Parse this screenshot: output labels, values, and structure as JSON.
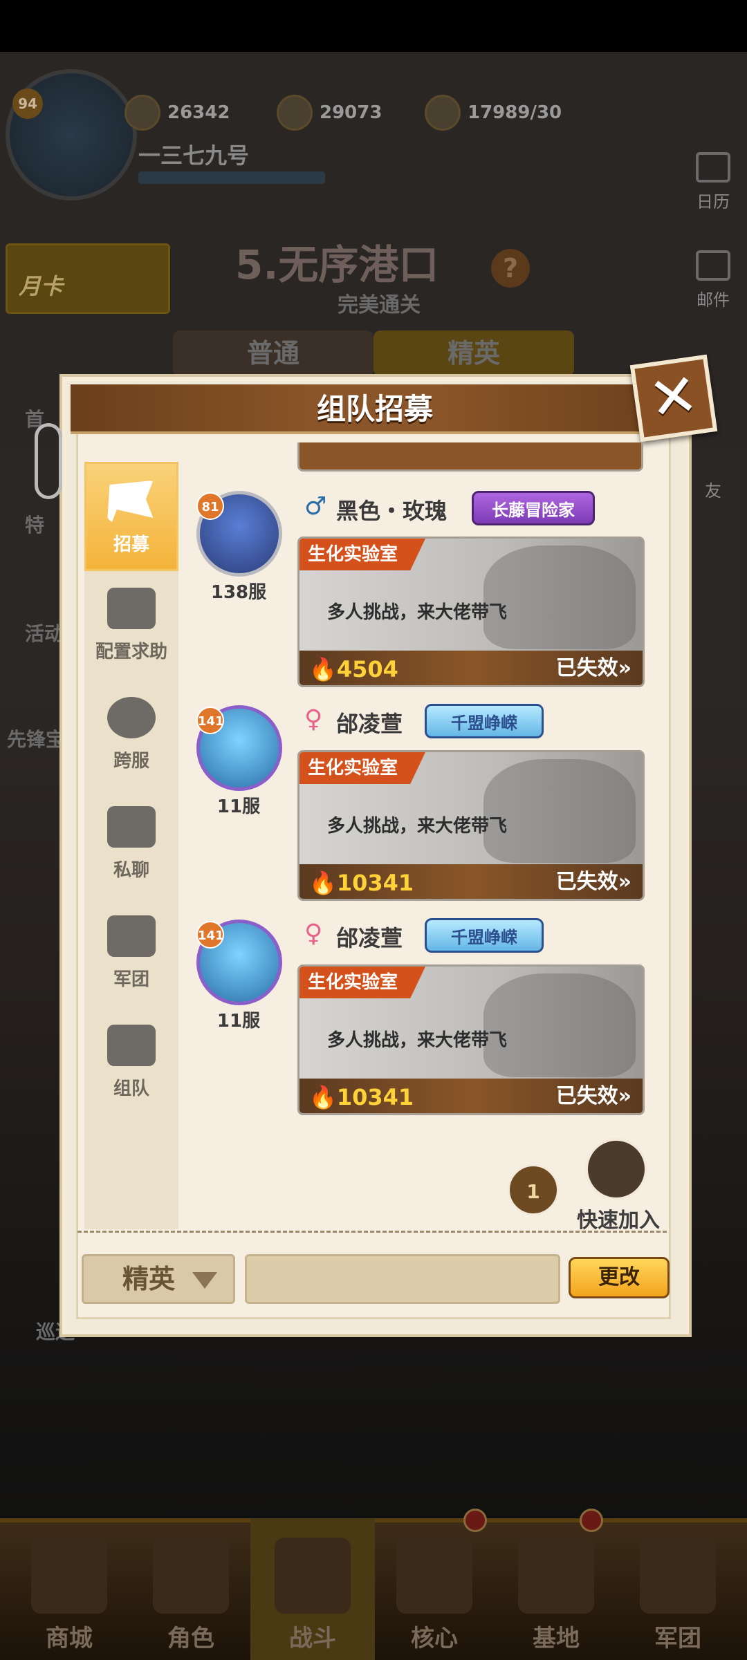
{
  "hud": {
    "level": "94",
    "player_name": "一三七九号",
    "resources": [
      "26342",
      "29073",
      "17989/30"
    ]
  },
  "right_menu": [
    {
      "label": "日历"
    },
    {
      "label": "邮件"
    },
    {
      "label": "友"
    }
  ],
  "left_menu": [
    {
      "label": "月卡"
    },
    {
      "label": "首"
    },
    {
      "label": "特"
    },
    {
      "label": "活动"
    },
    {
      "label": "先锋宝"
    },
    {
      "label": "巡逻"
    }
  ],
  "stage": {
    "title": "5.无序港口",
    "subtitle": "完美通关",
    "help": "?"
  },
  "difficulty_tabs": [
    {
      "label": "普通"
    },
    {
      "label": "精英"
    }
  ],
  "dialog": {
    "title": "组队招募",
    "close": "✕",
    "tabs": [
      {
        "label": "招募",
        "active": true
      },
      {
        "label": "配置求助"
      },
      {
        "label": "跨服"
      },
      {
        "label": "私聊"
      },
      {
        "label": "军团"
      },
      {
        "label": "组队"
      }
    ],
    "posts": [
      {
        "level": "81",
        "server": "138服",
        "gender": "♂",
        "gender_color": "#2a6ea8",
        "name": "黑色・玫瑰",
        "badge": "长藤冒险家",
        "badge_style": "purple",
        "tag": "生化实验室",
        "message": "多人挑战，来大佬带飞",
        "power": "4504",
        "status": "已失效»"
      },
      {
        "level": "141",
        "server": "11服",
        "gender": "♀",
        "gender_color": "#e8638a",
        "name": "邰凌萱",
        "badge": "千盟峥嵘",
        "badge_style": "blue",
        "tag": "生化实验室",
        "message": "多人挑战，来大佬带飞",
        "power": "10341",
        "status": "已失效»"
      },
      {
        "level": "141",
        "server": "11服",
        "gender": "♀",
        "gender_color": "#e8638a",
        "name": "邰凌萱",
        "badge": "千盟峥嵘",
        "badge_style": "blue",
        "tag": "生化实验室",
        "message": "多人挑战，来大佬带飞",
        "power": "10341",
        "status": "已失效»"
      }
    ],
    "quick_join_label": "快速加入",
    "queue_count": "1",
    "difficulty_select": "精英",
    "change_button": "更改"
  },
  "bottom_nav": [
    {
      "label": "商城"
    },
    {
      "label": "角色"
    },
    {
      "label": "战斗",
      "active": true
    },
    {
      "label": "核心"
    },
    {
      "label": "基地"
    },
    {
      "label": "军团"
    }
  ]
}
